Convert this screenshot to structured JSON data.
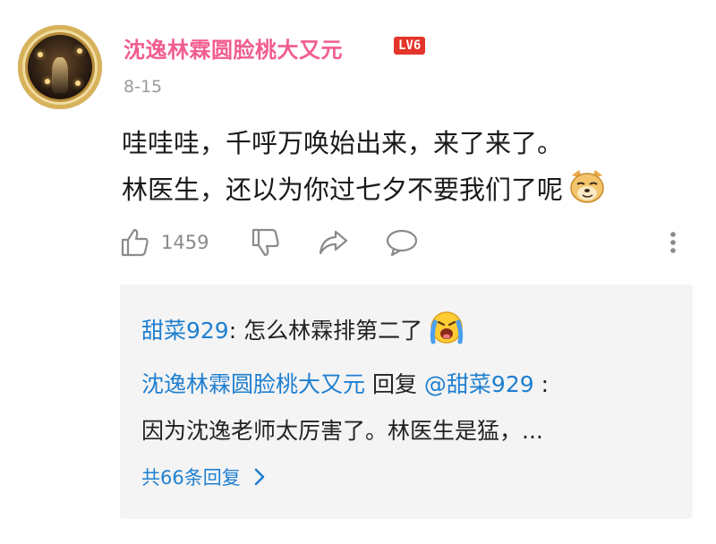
{
  "comment": {
    "username": "沈逸林霖圆脸桃大又元",
    "level": "LV6",
    "date": "8-15",
    "lines": [
      "哇哇哇，千呼万唤始出来，来了来了。",
      "林医生，还以为你过七夕不要我们了呢"
    ],
    "like_count": "1459",
    "icons": {
      "avatar": "avatar",
      "like": "thumbs-up-icon",
      "dislike": "thumbs-down-icon",
      "share": "share-icon",
      "reply": "comment-bubble-icon",
      "more": "more-vertical-icon",
      "doge": "doge-emoji",
      "cry": "crying-emoji"
    }
  },
  "replies": {
    "items": [
      {
        "user": "甜菜929",
        "sep": ": ",
        "text": "怎么林霖排第二了"
      },
      {
        "user": "沈逸林霖圆脸桃大又元",
        "reply_word": " 回复 ",
        "target": "@甜菜929",
        "sep": " :"
      },
      {
        "text": "因为沈逸老师太厉害了。林医生是猛，..."
      }
    ],
    "more_label": "共66条回复"
  },
  "colors": {
    "username_pink": "#f25d8e",
    "link_blue": "#1f7fd1",
    "level_red": "#e4352b",
    "meta_gray": "#9a9a9a",
    "reply_bg": "#f4f4f4"
  }
}
